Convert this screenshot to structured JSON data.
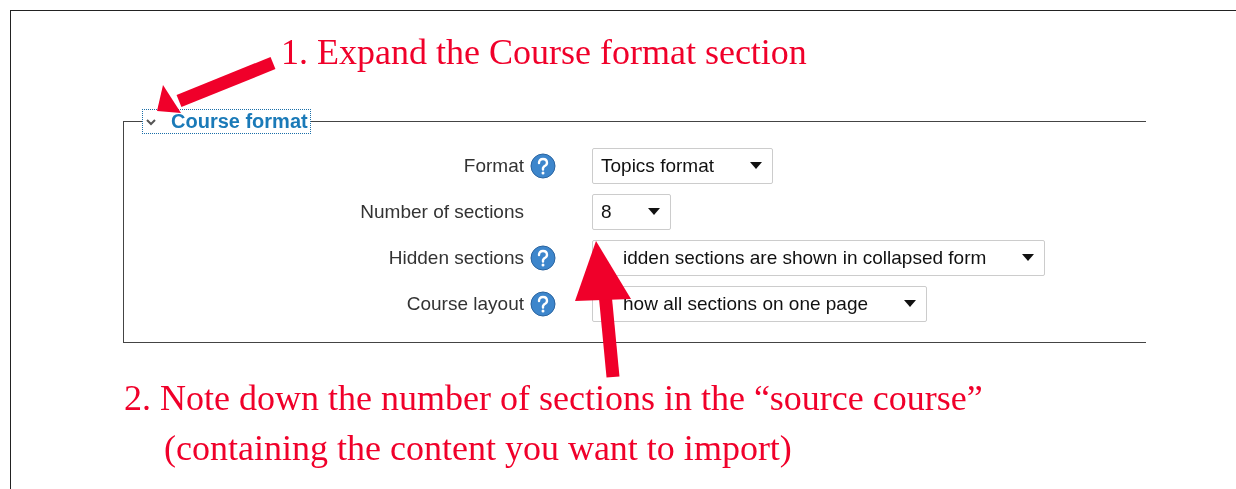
{
  "annotations": [
    {
      "lines": [
        "1. Expand the Course format section"
      ]
    },
    {
      "lines": [
        "2. Note down the number of sections in the “source course”",
        "(containing the content you want to import)"
      ]
    }
  ],
  "section": {
    "title": "Course format",
    "expanded": true,
    "fields": [
      {
        "label": "Format",
        "help": true,
        "value": "Topics format"
      },
      {
        "label": "Number of sections",
        "help": false,
        "value": "8"
      },
      {
        "label": "Hidden sections",
        "help": true,
        "value": "idden sections are shown in collapsed form"
      },
      {
        "label": "Course layout",
        "help": true,
        "value": "how all sections on one page"
      }
    ]
  }
}
